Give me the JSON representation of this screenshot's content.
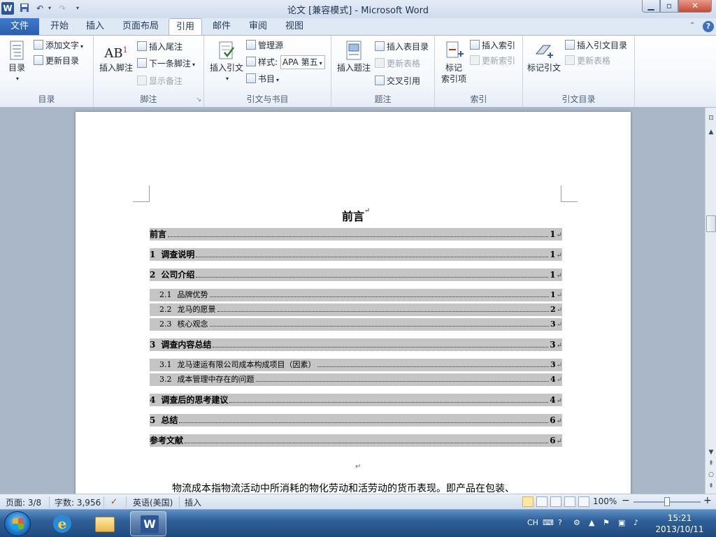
{
  "window": {
    "title": "论文 [兼容模式] - Microsoft Word",
    "logo": "W",
    "controls": {
      "minimize": "▁",
      "maximize": "▫",
      "close": "✕"
    }
  },
  "qat": {
    "save_icon": "save-icon",
    "undo_icon": "undo-icon",
    "redo_icon": "redo-icon",
    "customize_icon": "customize-qat-icon"
  },
  "tabs": {
    "file": "文件",
    "items": [
      "开始",
      "插入",
      "页面布局",
      "引用",
      "邮件",
      "审阅",
      "视图"
    ],
    "active": "引用",
    "help": "?"
  },
  "ribbon": {
    "toc_group": {
      "label": "目录",
      "toc_button": "目录",
      "add_text": "添加文字",
      "update_toc": "更新目录"
    },
    "footnote_group": {
      "label": "脚注",
      "insert_footnote": "插入脚注",
      "insert_endnote": "插入尾注",
      "next_footnote": "下一条脚注",
      "show_notes": "显示备注",
      "ab_glyph": "AB",
      "ab_sup": "1"
    },
    "citation_group": {
      "label": "引文与书目",
      "insert_citation": "插入引文",
      "manage_sources": "管理源",
      "style_label": "样式:",
      "style_value": "APA 第五",
      "bibliography": "书目"
    },
    "caption_group": {
      "label": "题注",
      "insert_caption": "插入题注",
      "insert_table_of_figures": "插入表目录",
      "update_table": "更新表格",
      "cross_reference": "交叉引用"
    },
    "index_group": {
      "label": "索引",
      "mark_entry_line1": "标记",
      "mark_entry_line2": "索引项",
      "insert_index": "插入索引",
      "update_index": "更新索引"
    },
    "authorities_group": {
      "label": "引文目录",
      "mark_citation": "标记引文",
      "insert_toa": "插入引文目录",
      "update_table": "更新表格"
    }
  },
  "document": {
    "heading": "前言",
    "toc": [
      {
        "num": "",
        "text": "前言",
        "page": "1",
        "level": 1
      },
      {
        "num": "1",
        "text": "调查说明",
        "page": "1",
        "level": 1
      },
      {
        "num": "2",
        "text": "公司介绍",
        "page": "1",
        "level": 1
      },
      {
        "num": "2.1",
        "text": "品牌优势",
        "page": "1",
        "level": 2
      },
      {
        "num": "2.2",
        "text": "龙马的愿景",
        "page": "2",
        "level": 2
      },
      {
        "num": "2.3",
        "text": "核心观念",
        "page": "3",
        "level": 2
      },
      {
        "num": "3",
        "text": "调查内容总结",
        "page": "3",
        "level": 1
      },
      {
        "num": "3.1",
        "text": "龙马速运有限公司成本构成项目（因素）",
        "page": "3",
        "level": 2
      },
      {
        "num": "3.2",
        "text": "成本管理中存在的问题",
        "page": "4",
        "level": 2
      },
      {
        "num": "4",
        "text": "调查后的思考建议",
        "page": "4",
        "level": 1
      },
      {
        "num": "5",
        "text": "总结",
        "page": "6",
        "level": 1
      },
      {
        "num": "",
        "text": "参考文献",
        "page": "6",
        "level": 1
      }
    ],
    "paragraph_mark": "↵",
    "body_text": "物流成本指物流活动中所消耗的物化劳动和活劳动的货币表现。即产品在包装、"
  },
  "statusbar": {
    "page": "页面: 3/8",
    "words": "字数: 3,956",
    "language": "英语(美国)",
    "mode": "插入",
    "zoom": "100%",
    "zoom_out": "−",
    "zoom_in": "+"
  },
  "taskbar": {
    "ime": "CH",
    "time": "15:21",
    "date": "2013/10/11",
    "apps": [
      "ie-icon",
      "explorer-icon",
      "word-icon"
    ]
  }
}
